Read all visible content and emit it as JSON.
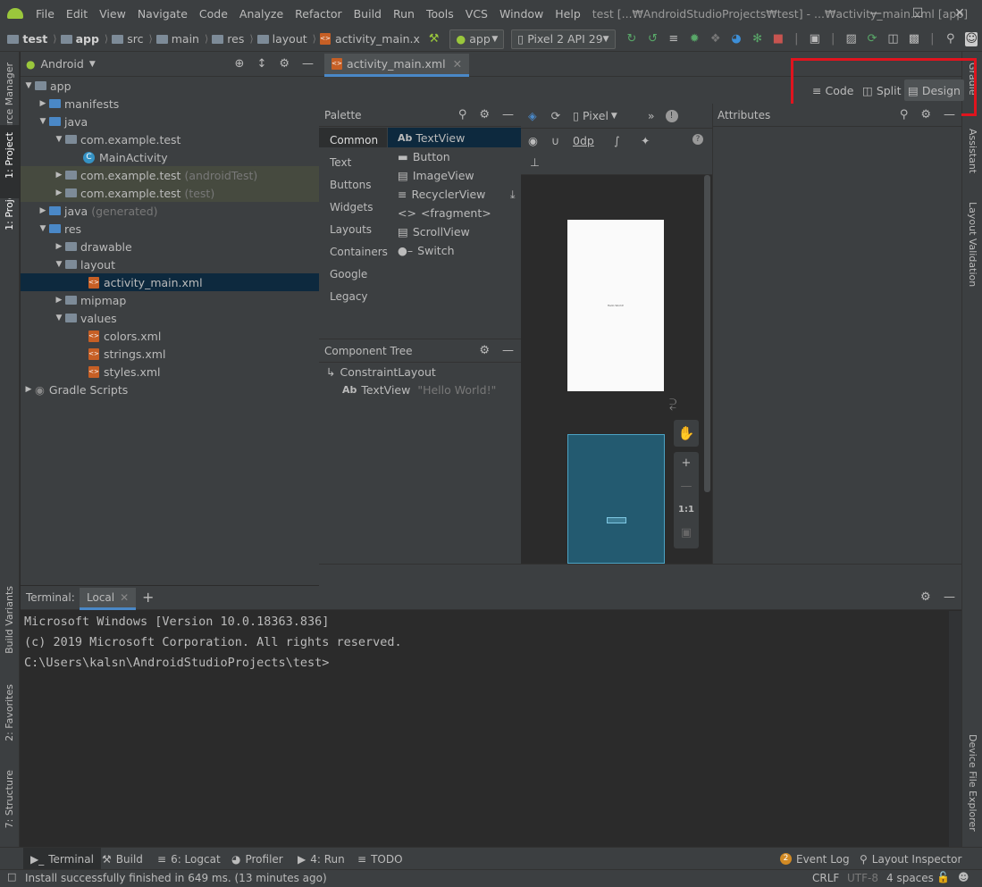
{
  "menu": {
    "items": [
      "File",
      "Edit",
      "View",
      "Navigate",
      "Code",
      "Analyze",
      "Refactor",
      "Build",
      "Run",
      "Tools",
      "VCS",
      "Window",
      "Help"
    ],
    "window_title": "test [...₩AndroidStudioProjects₩test] - ...₩activity_main.xml [app]"
  },
  "navbar": {
    "crumbs": [
      "test",
      "app",
      "src",
      "main",
      "res",
      "layout",
      "activity_main.x"
    ],
    "run_config": "app",
    "device": "Pixel 2 API 29"
  },
  "left_strip": {
    "resource_manager": "Resource Manager",
    "project": "1: Project",
    "build_variants": "Build Variants",
    "favorites": "2: Favorites",
    "structure": "7: Structure"
  },
  "right_strip": {
    "gradle": "Gradle",
    "assistant": "Assistant",
    "layout_validation": "Layout Validation",
    "device_file_explorer": "Device File Explorer"
  },
  "project": {
    "view_mode": "Android",
    "tree": [
      {
        "label": "app",
        "depth": 0
      },
      {
        "label": "manifests",
        "depth": 1
      },
      {
        "label": "java",
        "depth": 1
      },
      {
        "label": "com.example.test",
        "depth": 2
      },
      {
        "label": "MainActivity",
        "depth": 3
      },
      {
        "label": "com.example.test",
        "suffix": "(androidTest)",
        "depth": 2
      },
      {
        "label": "com.example.test",
        "suffix": "(test)",
        "depth": 2
      },
      {
        "label": "java",
        "suffix": "(generated)",
        "depth": 1
      },
      {
        "label": "res",
        "depth": 1
      },
      {
        "label": "drawable",
        "depth": 2
      },
      {
        "label": "layout",
        "depth": 2
      },
      {
        "label": "activity_main.xml",
        "depth": 3
      },
      {
        "label": "mipmap",
        "depth": 2
      },
      {
        "label": "values",
        "depth": 2
      },
      {
        "label": "colors.xml",
        "depth": 3
      },
      {
        "label": "strings.xml",
        "depth": 3
      },
      {
        "label": "styles.xml",
        "depth": 3
      },
      {
        "label": "Gradle Scripts",
        "depth": 0
      }
    ]
  },
  "editor": {
    "tab": "activity_main.xml",
    "modes": {
      "code": "Code",
      "split": "Split",
      "design": "Design"
    }
  },
  "palette": {
    "title": "Palette",
    "categories": [
      "Common",
      "Text",
      "Buttons",
      "Widgets",
      "Layouts",
      "Containers",
      "Google",
      "Legacy"
    ],
    "items": [
      "TextView",
      "Button",
      "ImageView",
      "RecyclerView",
      "<fragment>",
      "ScrollView",
      "Switch"
    ]
  },
  "design_toolbar": {
    "device": "Pixel",
    "margin": "0dp"
  },
  "component_tree": {
    "title": "Component Tree",
    "root": "ConstraintLayout",
    "child": "TextView",
    "child_text": "\"Hello World!\""
  },
  "attributes": {
    "title": "Attributes"
  },
  "preview": {
    "text": "Hello World!",
    "zoom_fit": "1:1"
  },
  "terminal": {
    "label": "Terminal:",
    "tab": "Local",
    "lines": [
      "Microsoft Windows [Version 10.0.18363.836]",
      "(c) 2019 Microsoft Corporation. All rights reserved.",
      "C:\\Users\\kalsn\\AndroidStudioProjects\\test>"
    ]
  },
  "bottom_tools": {
    "terminal": "Terminal",
    "build": "Build",
    "logcat": "6: Logcat",
    "profiler": "Profiler",
    "run": "4: Run",
    "todo": "TODO",
    "event_log": "Event Log",
    "event_count": "2",
    "layout_inspector": "Layout Inspector"
  },
  "status": {
    "message": "Install successfully finished in 649 ms. (13 minutes ago)",
    "line_sep": "CRLF",
    "encoding": "UTF-8",
    "indent": "4 spaces"
  },
  "colors": {
    "accent": "#4a88c7",
    "highlight": "#e0141e",
    "selection": "#0d293e",
    "blueprint": "#235a70"
  }
}
